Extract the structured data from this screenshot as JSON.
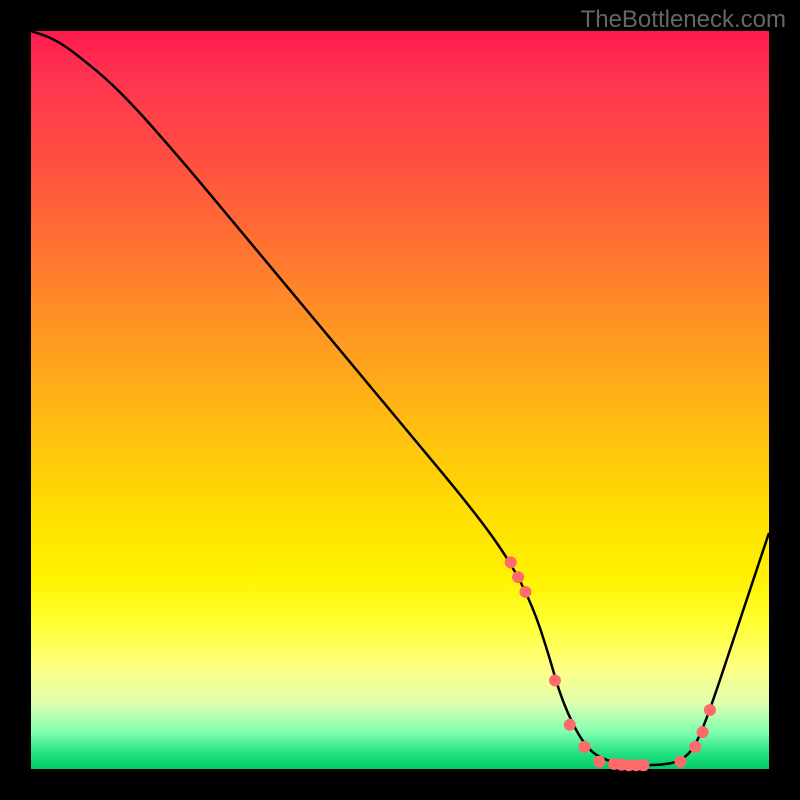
{
  "watermark": "TheBottleneck.com",
  "chart_data": {
    "type": "line",
    "title": "",
    "xlabel": "",
    "ylabel": "",
    "xlim": [
      0,
      100
    ],
    "ylim": [
      0,
      100
    ],
    "grid": false,
    "series": [
      {
        "name": "bottleneck-curve",
        "color": "#000000",
        "x": [
          0,
          3,
          6,
          12,
          20,
          30,
          40,
          50,
          60,
          65,
          68,
          70,
          72,
          75,
          78,
          82,
          85,
          88,
          90,
          92,
          95,
          100
        ],
        "values": [
          100,
          99,
          97,
          92,
          83,
          71,
          59,
          47,
          35,
          28,
          22,
          16,
          9,
          3,
          1,
          0.5,
          0.5,
          1,
          3,
          8,
          17,
          32
        ]
      }
    ],
    "markers": {
      "name": "highlight-dots",
      "color": "#ff6a6a",
      "radius": 6,
      "x": [
        65,
        66,
        67,
        71,
        73,
        75,
        77,
        79,
        80,
        81,
        82,
        83,
        88,
        90,
        91,
        92
      ],
      "values": [
        28,
        26,
        24,
        12,
        6,
        3,
        1,
        0.7,
        0.6,
        0.5,
        0.5,
        0.5,
        1,
        3,
        5,
        8
      ]
    },
    "gradient_stops": [
      {
        "pos": 0,
        "color": "#ff1a4d"
      },
      {
        "pos": 18,
        "color": "#ff5040"
      },
      {
        "pos": 42,
        "color": "#ff9a20"
      },
      {
        "pos": 66,
        "color": "#ffe000"
      },
      {
        "pos": 86,
        "color": "#ffff80"
      },
      {
        "pos": 95,
        "color": "#80ffb0"
      },
      {
        "pos": 100,
        "color": "#00cc66"
      }
    ]
  }
}
